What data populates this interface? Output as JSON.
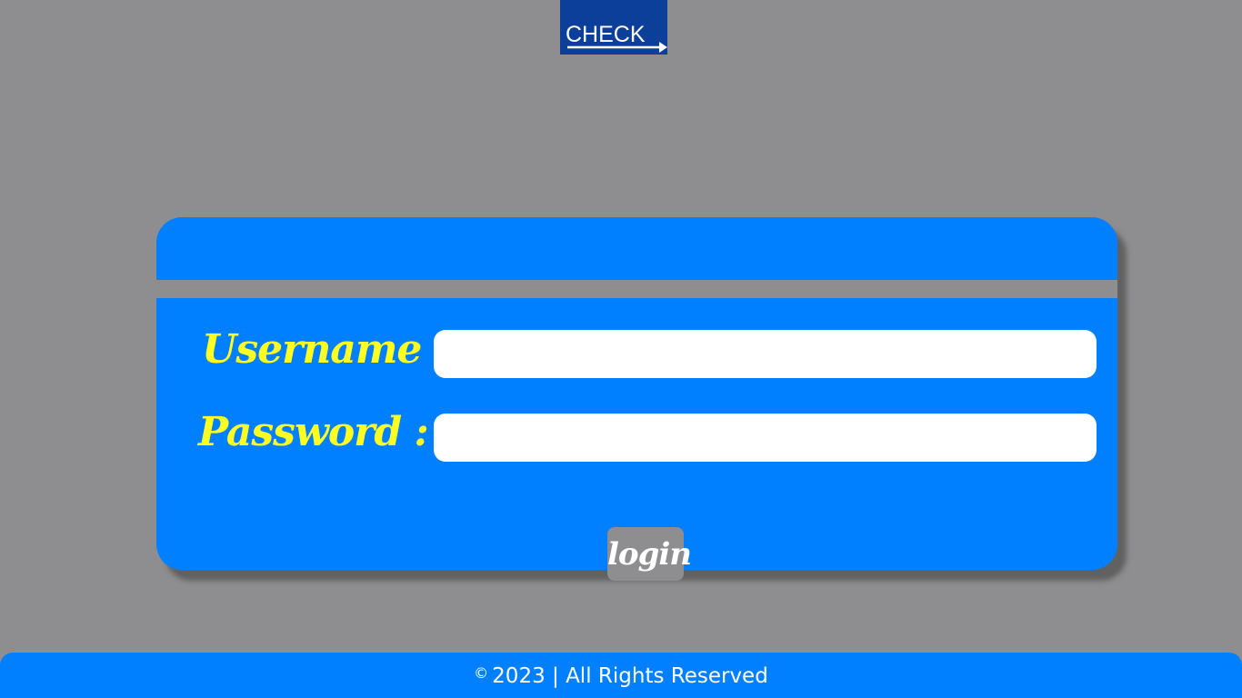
{
  "header": {
    "logo_text": "CHECK",
    "logo_bg_color": "#0c3f9a"
  },
  "login_form": {
    "username_label": "Username :",
    "username_value": "",
    "password_label": "Password :",
    "password_value": "",
    "login_label": "login",
    "card_color": "#0080ff",
    "label_color": "#ffff22"
  },
  "footer": {
    "copyright_symbol": "©",
    "text": "2023 | All Rights Reserved",
    "bg_color": "#0080ff"
  }
}
